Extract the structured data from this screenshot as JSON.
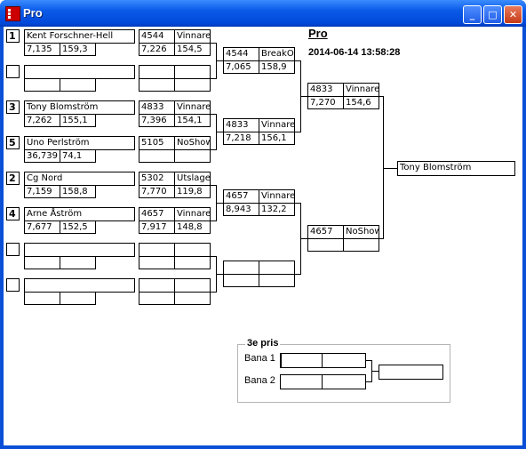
{
  "window": {
    "title": "Pro",
    "icon": "app-icon"
  },
  "header": {
    "title": "Pro",
    "datetime": "2014-06-14 13:58:28"
  },
  "round1": [
    {
      "seed": "1",
      "name": "Kent Forschner-Hell",
      "rt": "7,135",
      "speed": "159,3"
    },
    {
      "seed": "",
      "name": "",
      "rt": "",
      "speed": ""
    },
    {
      "seed": "3",
      "name": "Tony Blomström",
      "rt": "7,262",
      "speed": "155,1"
    },
    {
      "seed": "5",
      "name": "Uno Perlström",
      "rt": "36,739",
      "speed": "74,1"
    },
    {
      "seed": "2",
      "name": "Cg Nord",
      "rt": "7,159",
      "speed": "158,8"
    },
    {
      "seed": "4",
      "name": "Arne Åström",
      "rt": "7,677",
      "speed": "152,5"
    },
    {
      "seed": "",
      "name": "",
      "rt": "",
      "speed": ""
    },
    {
      "seed": "",
      "name": "",
      "rt": "",
      "speed": ""
    }
  ],
  "round2": [
    {
      "id": "4544",
      "result": "Vinnare",
      "rt": "7,226",
      "speed": "154,5"
    },
    {
      "id": "",
      "result": "",
      "rt": "",
      "speed": ""
    },
    {
      "id": "4833",
      "result": "Vinnare",
      "rt": "7,396",
      "speed": "154,1"
    },
    {
      "id": "5105",
      "result": "NoShow",
      "rt": "",
      "speed": ""
    },
    {
      "id": "5302",
      "result": "Utslagen",
      "rt": "7,770",
      "speed": "119,8"
    },
    {
      "id": "4657",
      "result": "Vinnare",
      "rt": "7,917",
      "speed": "148,8"
    },
    {
      "id": "",
      "result": "",
      "rt": "",
      "speed": ""
    },
    {
      "id": "",
      "result": "",
      "rt": "",
      "speed": ""
    }
  ],
  "round3": [
    {
      "id": "4544",
      "result": "BreakOut",
      "rt": "7,065",
      "speed": "158,9"
    },
    {
      "id": "4833",
      "result": "Vinnare",
      "rt": "7,218",
      "speed": "156,1"
    },
    {
      "id": "4657",
      "result": "Vinnare",
      "rt": "8,943",
      "speed": "132,2"
    },
    {
      "id": "",
      "result": "",
      "rt": "",
      "speed": ""
    }
  ],
  "round4": [
    {
      "id": "4833",
      "result": "Vinnare",
      "rt": "7,270",
      "speed": "154,6"
    },
    {
      "id": "4657",
      "result": "NoShow",
      "rt": "",
      "speed": ""
    }
  ],
  "winner": "Tony Blomström",
  "third": {
    "legend": "3e pris",
    "lane1": "Bana 1",
    "lane2": "Bana 2"
  }
}
